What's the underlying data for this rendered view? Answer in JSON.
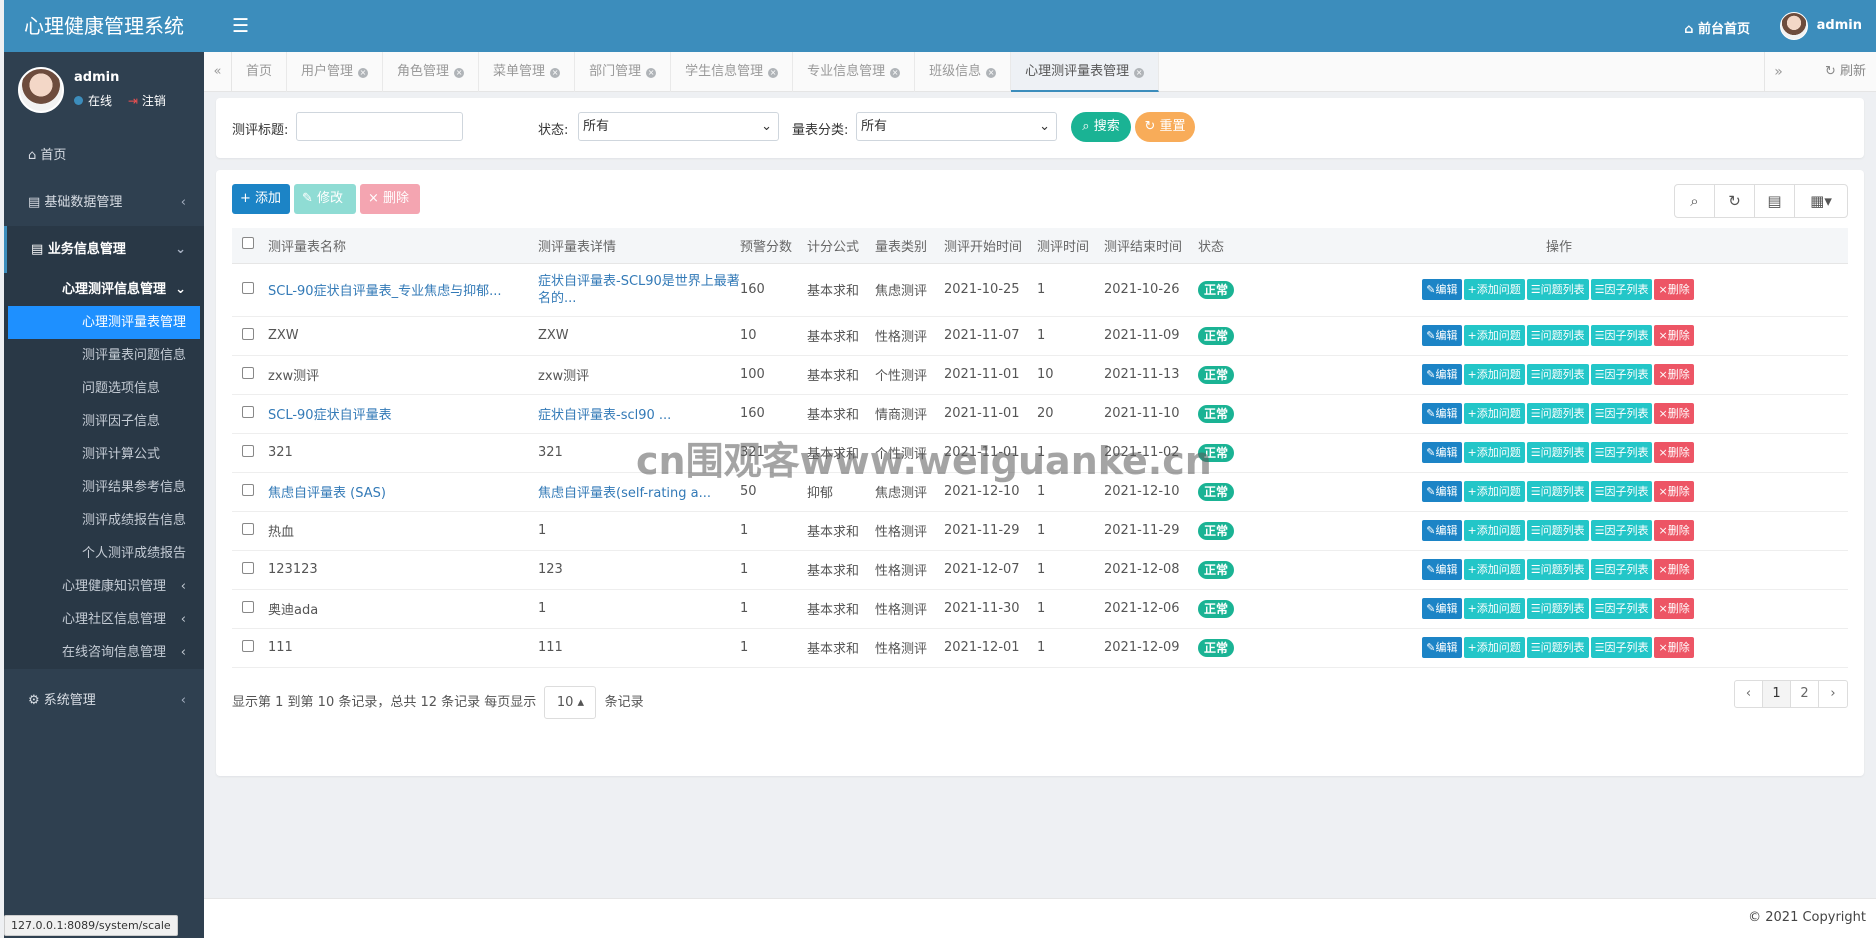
{
  "app": {
    "title": "心理健康管理系统"
  },
  "sidebar": {
    "user_name": "admin",
    "online": "在线",
    "logout": "注销",
    "menus": [
      "首页",
      "基础数据管理",
      "业务信息管理",
      "系统管理"
    ],
    "business_children": [
      "心理测评信息管理",
      "心理测评量表管理",
      "测评量表问题信息",
      "问题选项信息",
      "测评因子信息",
      "测评计算公式",
      "测评结果参考信息",
      "测评成绩报告信息",
      "个人测评成绩报告",
      "心理健康知识管理",
      "心理社区信息管理",
      "在线咨询信息管理"
    ]
  },
  "topbar": {
    "home": "前台首页",
    "user": "admin"
  },
  "tabs": [
    "首页",
    "用户管理",
    "角色管理",
    "菜单管理",
    "部门管理",
    "学生信息管理",
    "专业信息管理",
    "班级信息",
    "心理测评量表管理"
  ],
  "tabs_extra": {
    "refresh": "刷新"
  },
  "search": {
    "title_label": "测评标题:",
    "status_label": "状态:",
    "status_value": "所有",
    "category_label": "量表分类:",
    "category_value": "所有",
    "search_button": "搜索",
    "reset_button": "重置"
  },
  "toolbar": {
    "add": "添加",
    "edit": "修改",
    "delete": "删除"
  },
  "table": {
    "headers": [
      "测评量表名称",
      "测评量表详情",
      "预警分数",
      "计分公式",
      "量表类别",
      "测评开始时间",
      "测评时间",
      "测评结束时间",
      "状态",
      "操作"
    ],
    "rows": [
      [
        "SCL-90症状自评量表_专业焦虑与抑郁...",
        "症状自评量表-SCL90是世界上最著名的...",
        "160",
        "基本求和",
        "焦虑测评",
        "2021-10-25",
        "1",
        "2021-10-26",
        "正常"
      ],
      [
        "ZXW",
        "ZXW",
        "10",
        "基本求和",
        "性格测评",
        "2021-11-07",
        "1",
        "2021-11-09",
        "正常"
      ],
      [
        "zxw测评",
        "zxw测评",
        "100",
        "基本求和",
        "个性测评",
        "2021-11-01",
        "10",
        "2021-11-13",
        "正常"
      ],
      [
        "SCL-90症状自评量表",
        "症状自评量表-scl90 ...",
        "160",
        "基本求和",
        "情商测评",
        "2021-11-01",
        "20",
        "2021-11-10",
        "正常"
      ],
      [
        "321",
        "321",
        "321",
        "基本求和",
        "个性测评",
        "2021-11-01",
        "1",
        "2021-11-02",
        "正常"
      ],
      [
        "焦虑自评量表 (SAS)",
        "焦虑自评量表(self-rating a...",
        "50",
        "抑郁",
        "焦虑测评",
        "2021-12-10",
        "1",
        "2021-12-10",
        "正常"
      ],
      [
        "热血",
        "1",
        "1",
        "基本求和",
        "性格测评",
        "2021-11-29",
        "1",
        "2021-11-29",
        "正常"
      ],
      [
        "123123",
        "123",
        "1",
        "基本求和",
        "性格测评",
        "2021-12-07",
        "1",
        "2021-12-08",
        "正常"
      ],
      [
        "奥迪ada",
        "1",
        "1",
        "基本求和",
        "性格测评",
        "2021-11-30",
        "1",
        "2021-12-06",
        "正常"
      ],
      [
        "111",
        "111",
        "1",
        "基本求和",
        "性格测评",
        "2021-12-01",
        "1",
        "2021-12-09",
        "正常"
      ]
    ],
    "actions": [
      "编辑",
      "添加问题",
      "问题列表",
      "因子列表",
      "删除"
    ]
  },
  "pagination": {
    "info_prefix": "显示第 1 到第 10 条记录，总共 12 条记录",
    "per_page_label": "每页显示",
    "per_page_value": "10",
    "records_label": "条记录",
    "pages": [
      "1",
      "2"
    ]
  },
  "footer": {
    "copyright": "© 2021 Copyright"
  },
  "status_bar": {
    "url": "127.0.0.1:8089/system/scale"
  },
  "overlay": {
    "watermark": "cn围观客www.weiguanke.cn"
  }
}
